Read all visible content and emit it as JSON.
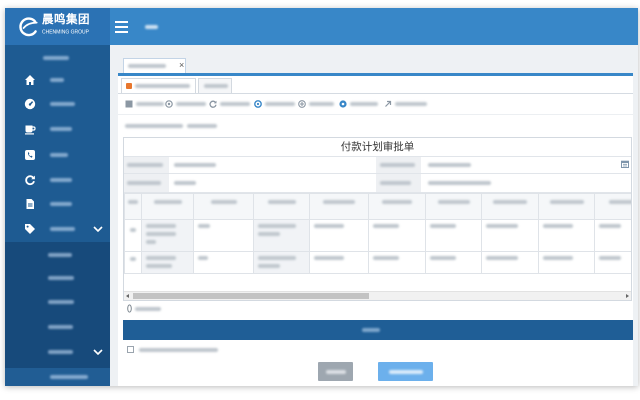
{
  "brand": {
    "name": "晨鸣集团",
    "subtitle": "CHENMING GROUP",
    "logo_icon": "chenming-logo-icon"
  },
  "theme": {
    "sidebar_bg": "#1e5b92",
    "submenu_bg": "#174a7b",
    "selected_item_bg": "#215d94",
    "logo_bg": "#2b72b4",
    "header_bg": "#3887c8",
    "accent": "#3887c8",
    "section_bar_bg": "#1f5e96",
    "primary_button_bg": "#6cb0ec",
    "secondary_button_bg": "#9ea7b0",
    "tab_icon": "#e8772e"
  },
  "header": {
    "menu_icon": "hamburger-icon"
  },
  "sidebar": {
    "items": [
      {
        "icon": "home-icon"
      },
      {
        "icon": "dashboard-icon"
      },
      {
        "icon": "cup-icon"
      },
      {
        "icon": "phone-icon"
      },
      {
        "icon": "refresh-icon"
      },
      {
        "icon": "document-icon"
      },
      {
        "icon": "tag-icon",
        "expanded": true
      }
    ],
    "expand_icon": "chevron-down-icon"
  },
  "tabs": [
    {
      "close_label": "×",
      "active": true
    }
  ],
  "toolbar": {
    "icons": [
      "square-icon",
      "target-icon",
      "refresh-icon",
      "ring-icon",
      "plus-circle-icon",
      "dot-circle-icon",
      "arrow-icon"
    ]
  },
  "form": {
    "title": "付款计划审批单",
    "date_icon": "calendar-icon",
    "attachment_icon": "attachment-icon"
  }
}
